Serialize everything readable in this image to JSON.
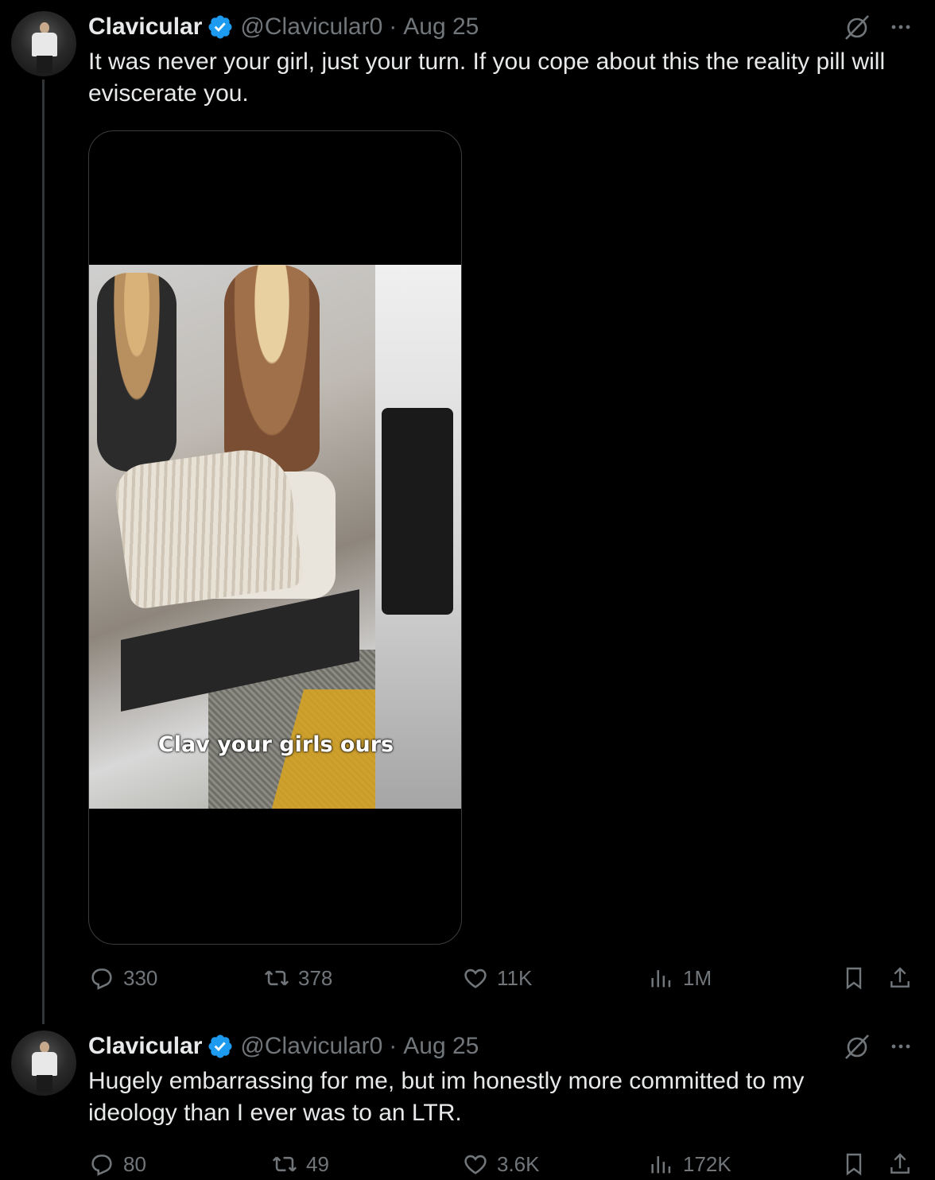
{
  "tweets": [
    {
      "name": "Clavicular",
      "handle": "@Clavicular0",
      "separator": "·",
      "date": "Aug 25",
      "text": "It was never your girl, just your turn. If you cope about this the reality pill will eviscerate you.",
      "media": {
        "caption": "Clav your girls ours"
      },
      "stats": {
        "replies": "330",
        "reposts": "378",
        "likes": "11K",
        "views": "1M"
      }
    },
    {
      "name": "Clavicular",
      "handle": "@Clavicular0",
      "separator": "·",
      "date": "Aug 25",
      "text": "Hugely embarrassing for me, but im honestly more committed to my ideology than I ever was to an LTR.",
      "stats": {
        "replies": "80",
        "reposts": "49",
        "likes": "3.6K",
        "views": "172K"
      }
    }
  ],
  "colors": {
    "background": "#000000",
    "text": "#e7e9ea",
    "muted": "#71767b",
    "verified": "#1d9bf0"
  },
  "icons": [
    "verified-badge-icon",
    "grok-icon",
    "more-icon",
    "reply-icon",
    "repost-icon",
    "like-icon",
    "views-icon",
    "bookmark-icon",
    "share-icon"
  ]
}
